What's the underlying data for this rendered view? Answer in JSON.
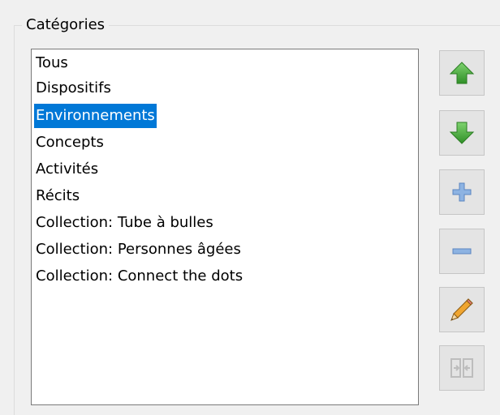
{
  "group": {
    "title": "Catégories"
  },
  "categories": [
    "Tous",
    "Dispositifs",
    "Environnements",
    "Concepts",
    "Activités",
    "Récits",
    "Collection: Tube à bulles",
    "Collection: Personnes âgées",
    "Collection: Connect the dots"
  ],
  "selected_index": 2,
  "toolbar": {
    "buttons": [
      {
        "name": "move-up-button",
        "icon": "arrow-up-icon",
        "color": "#3fa535"
      },
      {
        "name": "move-down-button",
        "icon": "arrow-down-icon",
        "color": "#3fa535"
      },
      {
        "name": "add-button",
        "icon": "plus-icon",
        "color": "#6f9fd8"
      },
      {
        "name": "remove-button",
        "icon": "minus-icon",
        "color": "#6f9fd8"
      },
      {
        "name": "rename-button",
        "icon": "pencil-icon",
        "color": "#e08a1e"
      },
      {
        "name": "merge-button",
        "icon": "merge-icon",
        "color": "#b5b5b5"
      }
    ]
  },
  "colors": {
    "selection": "#0078d7",
    "window_bg": "#f0f0f0"
  }
}
